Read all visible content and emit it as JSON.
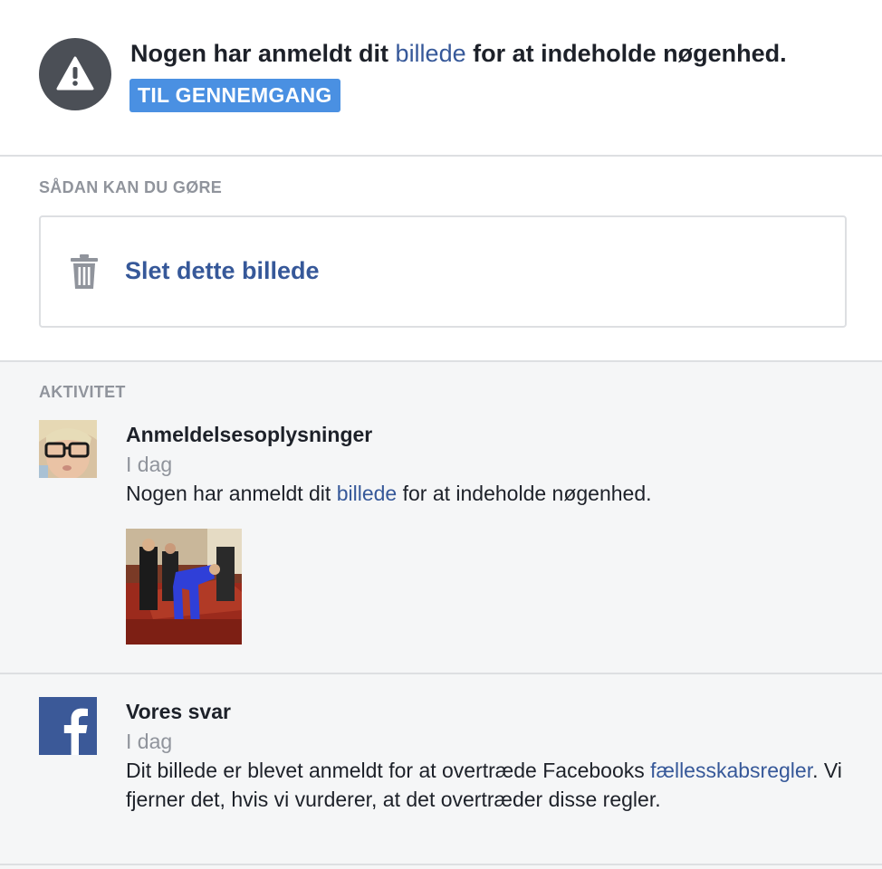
{
  "notice": {
    "headline_before": "Nogen har anmeldt dit",
    "headline_link": "billede",
    "headline_after": "for at indeholde nøgenhed.",
    "review_button": "TIL GENNEMGANG",
    "icon": "warning-icon"
  },
  "actions": {
    "section_label": "SÅDAN KAN DU GØRE",
    "delete_label": "Slet dette billede",
    "icon": "trash-icon"
  },
  "activity": {
    "section_label": "AKTIVITET",
    "items": [
      {
        "title": "Anmeldelsesoplysninger",
        "time": "I dag",
        "text_before": "Nogen har anmeldt dit",
        "text_link": "billede",
        "text_after": "for at indeholde nøgenhed."
      },
      {
        "title": "Vores svar",
        "time": "I dag",
        "text_before": "Dit billede er blevet anmeldt for at overtræde Facebooks",
        "text_link": "fællesskabsregler",
        "text_after": ". Vi fjerner det, hvis vi vurderer, at det overtræder disse regler."
      }
    ]
  },
  "colors": {
    "link": "#365899",
    "button": "#4a90e2",
    "muted": "#90949c",
    "activity_bg": "#f5f6f7",
    "facebook_blue": "#3b5998"
  }
}
